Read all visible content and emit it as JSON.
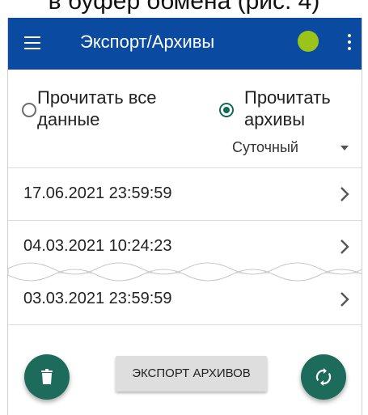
{
  "top_caption": "в буфер обмена (рис. 4)",
  "app_bar": {
    "title": "Экспорт/Архивы",
    "status_dot_color": "#9bc41a",
    "accent": "#0b4aa1"
  },
  "read_mode": {
    "options": [
      {
        "label_line1": "Прочитать все",
        "label_line2": "данные",
        "selected": false
      },
      {
        "label_line1": "Прочитать",
        "label_line2": "архивы",
        "selected": true
      }
    ],
    "archive_type": "Суточный"
  },
  "archives": [
    "17.06.2021 23:59:59",
    "04.03.2021 10:24:23",
    "03.03.2021 23:59:59"
  ],
  "actions": {
    "export_label": "ЭКСПОРТ АРХИВОВ",
    "fab_color": "#1c6b5b"
  }
}
